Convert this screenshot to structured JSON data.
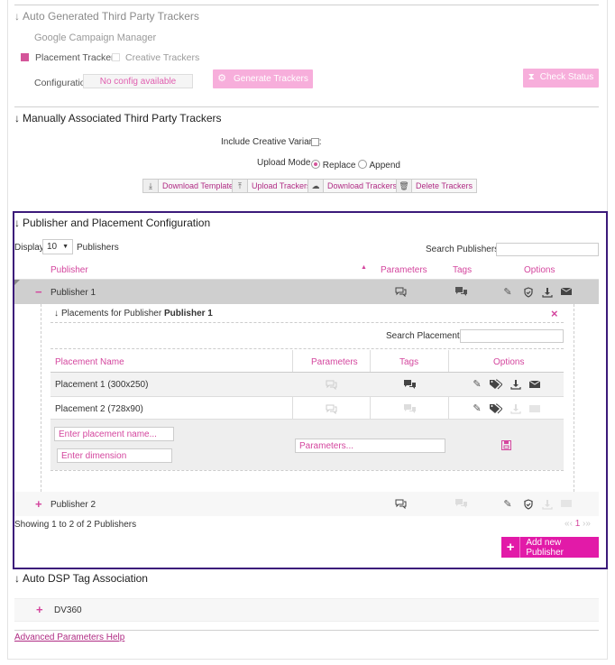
{
  "auto_trackers": {
    "title": "Auto Generated Third Party Trackers",
    "provider": "Google Campaign Manager",
    "placement_trackers_label": "Placement Trackers",
    "creative_trackers_label": "Creative Trackers",
    "configuration_label": "Configuration",
    "config_value": "No config available",
    "generate_button": "Generate Trackers",
    "check_status_button": "Check Status"
  },
  "manual_trackers": {
    "title": "Manually Associated Third Party Trackers",
    "include_creative_label": "Include Creative Variant :",
    "upload_mode_label": "Upload Mode :",
    "replace_label": "Replace",
    "append_label": "Append",
    "download_template": "Download Template",
    "upload_trackers": "Upload Trackers",
    "download_trackers": "Download Trackers",
    "delete_trackers": "Delete Trackers"
  },
  "publisher_config": {
    "title": "Publisher and Placement Configuration",
    "display_label": "Display",
    "display_value": "10",
    "publishers_label": "Publishers",
    "search_label": "Search Publishers :",
    "columns": {
      "publisher": "Publisher",
      "parameters": "Parameters",
      "tags": "Tags",
      "options": "Options"
    },
    "publishers": [
      {
        "toggle": "−",
        "name": "Publisher 1"
      },
      {
        "toggle": "+",
        "name": "Publisher 2"
      }
    ],
    "placements": {
      "title_prefix": "Placements for Publisher",
      "title_publisher": "Publisher 1",
      "close": "×",
      "search_label": "Search Placements :",
      "columns": {
        "name": "Placement Name",
        "parameters": "Parameters",
        "tags": "Tags",
        "options": "Options"
      },
      "rows": [
        {
          "name": "Placement 1 (300x250)"
        },
        {
          "name": "Placement 2 (728x90)"
        }
      ],
      "new_name_placeholder": "Enter placement name...",
      "new_dimension_placeholder": "Enter dimension",
      "new_parameters_placeholder": "Parameters..."
    },
    "showing_text": "Showing 1 to 2 of 2 Publishers",
    "pagination": {
      "first": "«",
      "prev": "‹",
      "page": "1",
      "next": "›",
      "last": "»"
    },
    "add_publisher": "Add new Publisher"
  },
  "dsp": {
    "title": "Auto DSP Tag Association",
    "item": "DV360",
    "toggle": "+"
  },
  "help_link": "Advanced Parameters Help",
  "colors": {
    "accent": "#e21aa8",
    "accent_light": "#f7aedb",
    "panel_border": "#3c1a7a"
  }
}
